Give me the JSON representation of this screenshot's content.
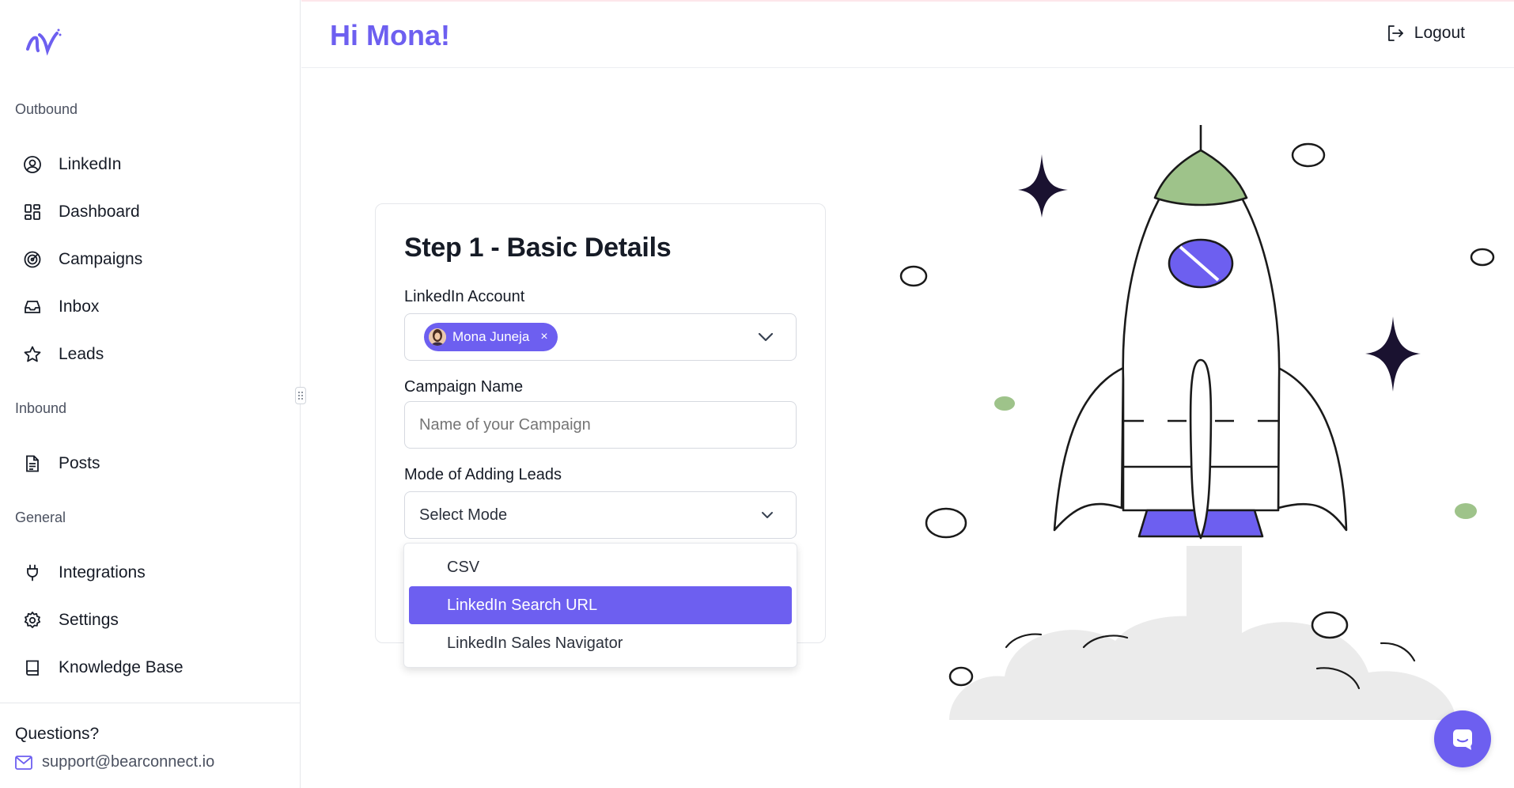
{
  "header": {
    "greeting": "Hi Mona!",
    "logout_label": "Logout"
  },
  "sidebar": {
    "sections": [
      {
        "label": "Outbound"
      },
      {
        "label": "Inbound"
      },
      {
        "label": "General"
      }
    ],
    "items": [
      {
        "label": "LinkedIn",
        "icon": "user-circle-icon"
      },
      {
        "label": "Dashboard",
        "icon": "grid-icon"
      },
      {
        "label": "Campaigns",
        "icon": "target-icon"
      },
      {
        "label": "Inbox",
        "icon": "inbox-icon"
      },
      {
        "label": "Leads",
        "icon": "star-icon"
      },
      {
        "label": "Posts",
        "icon": "document-icon"
      },
      {
        "label": "Integrations",
        "icon": "plug-icon"
      },
      {
        "label": "Settings",
        "icon": "gear-icon"
      },
      {
        "label": "Knowledge Base",
        "icon": "book-icon"
      }
    ],
    "footer": {
      "questions": "Questions?",
      "support_email": "support@bearconnect.io"
    }
  },
  "form": {
    "title": "Step 1 - Basic Details",
    "linkedin_account": {
      "label": "LinkedIn Account",
      "selected": "Mona Juneja",
      "remove": "×"
    },
    "campaign_name": {
      "label": "Campaign Name",
      "placeholder": "Name of your Campaign",
      "value": ""
    },
    "mode": {
      "label": "Mode of Adding Leads",
      "value": "Select Mode",
      "options": [
        "CSV",
        "LinkedIn Search URL",
        "LinkedIn Sales Navigator"
      ],
      "highlighted": "LinkedIn Search URL"
    }
  },
  "colors": {
    "accent": "#6d5ff0",
    "rocket_nose": "#9ec38a",
    "dark_star": "#1a1230",
    "cloud": "#ebebeb"
  }
}
